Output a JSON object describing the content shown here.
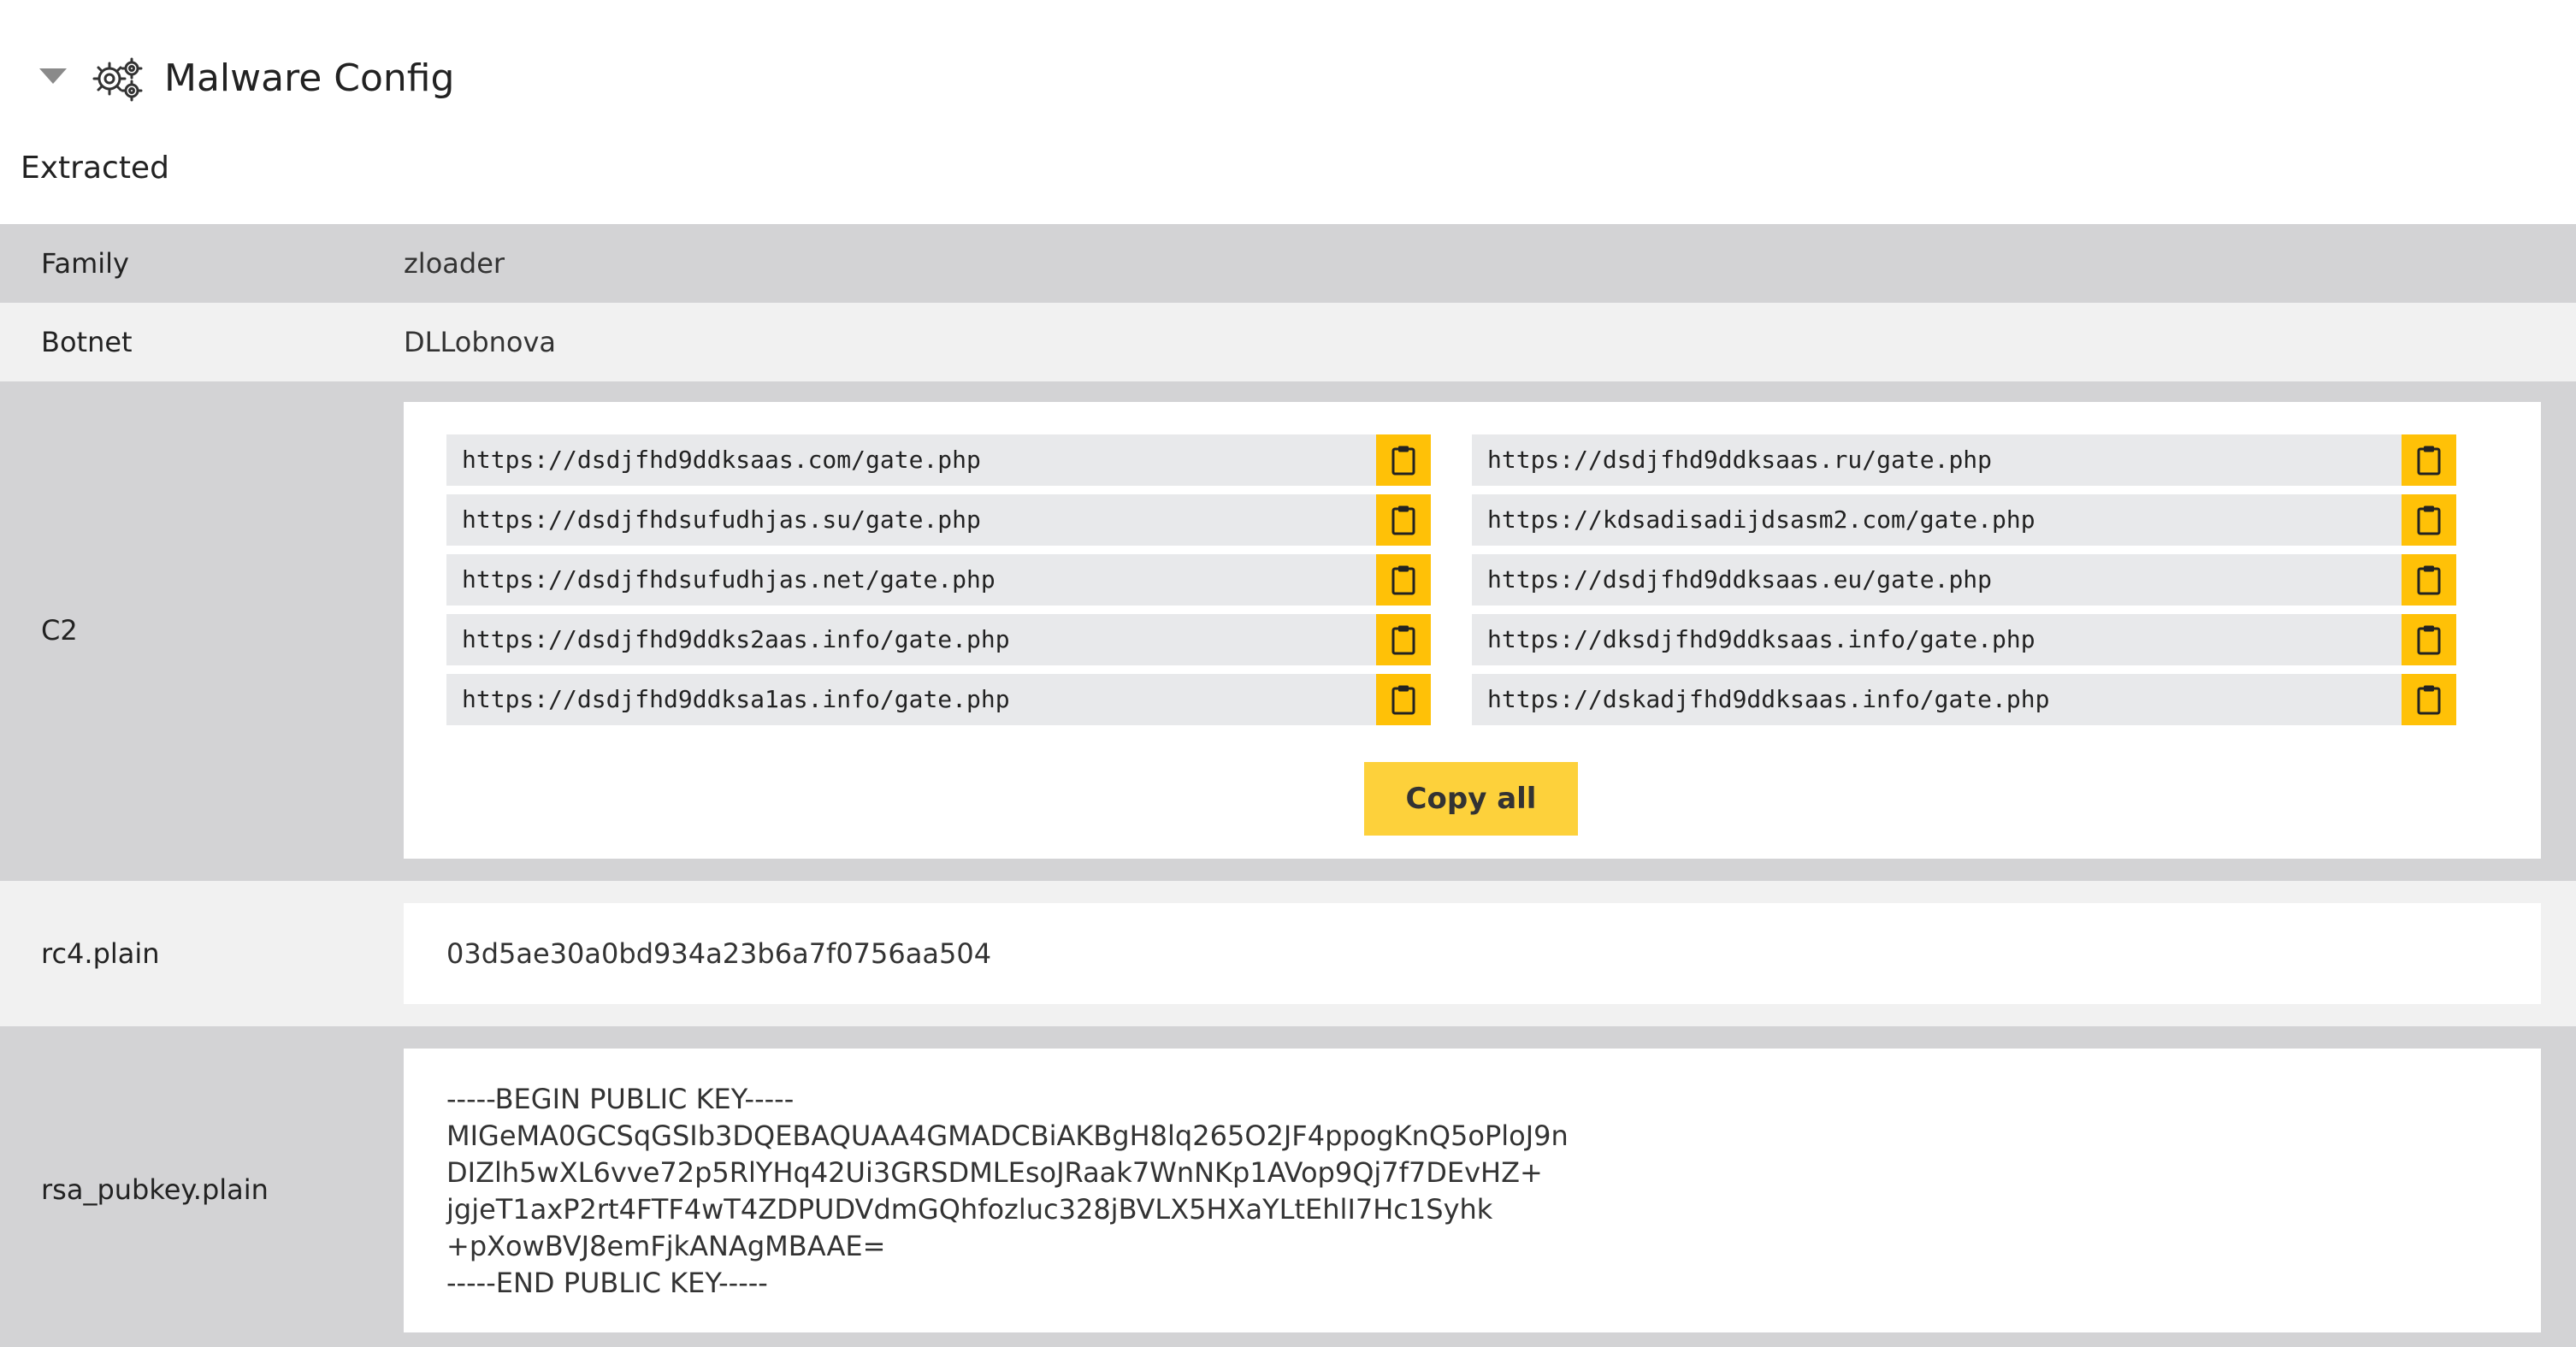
{
  "section": {
    "title": "Malware Config",
    "subsection": "Extracted"
  },
  "rows": {
    "family": {
      "key": "Family",
      "value": "zloader"
    },
    "botnet": {
      "key": "Botnet",
      "value": "DLLobnova"
    },
    "c2": {
      "key": "C2",
      "urls": [
        "https://dsdjfhd9ddksaas.com/gate.php",
        "https://dsdjfhd9ddksaas.ru/gate.php",
        "https://dsdjfhdsufudhjas.su/gate.php",
        "https://kdsadisadijdsasm2.com/gate.php",
        "https://dsdjfhdsufudhjas.net/gate.php",
        "https://dsdjfhd9ddksaas.eu/gate.php",
        "https://dsdjfhd9ddks2aas.info/gate.php",
        "https://dksdjfhd9ddksaas.info/gate.php",
        "https://dsdjfhd9ddksa1as.info/gate.php",
        "https://dskadjfhd9ddksaas.info/gate.php"
      ],
      "copy_all_label": "Copy all"
    },
    "rc4": {
      "key": "rc4.plain",
      "value": "03d5ae30a0bd934a23b6a7f0756aa504"
    },
    "rsa": {
      "key": "rsa_pubkey.plain",
      "value": "-----BEGIN PUBLIC KEY-----\nMIGeMA0GCSqGSIb3DQEBAQUAA4GMADCBiAKBgH8lq265O2JF4ppogKnQ5oPloJ9n\nDIZlh5wXL6vve72p5RlYHq42Ui3GRSDMLEsoJRaak7WnNKp1AVop9Qj7f7DEvHZ+\njgjeT1axP2rt4FTF4wT4ZDPUDVdmGQhfozluc328jBVLX5HXaYLtEhlI7Hc1Syhk\n+pXowBVJ8emFjkANAgMBAAE=\n-----END PUBLIC KEY-----"
    }
  },
  "icons": {
    "collapse": "caret-down-icon",
    "section": "gears-icon",
    "copy": "clipboard-icon"
  },
  "colors": {
    "accent": "#ffc107",
    "copy_all_bg": "#fdd13b",
    "row_dark": "#d3d3d5",
    "row_light": "#f1f1f1",
    "url_bg": "#e8e9eb"
  }
}
